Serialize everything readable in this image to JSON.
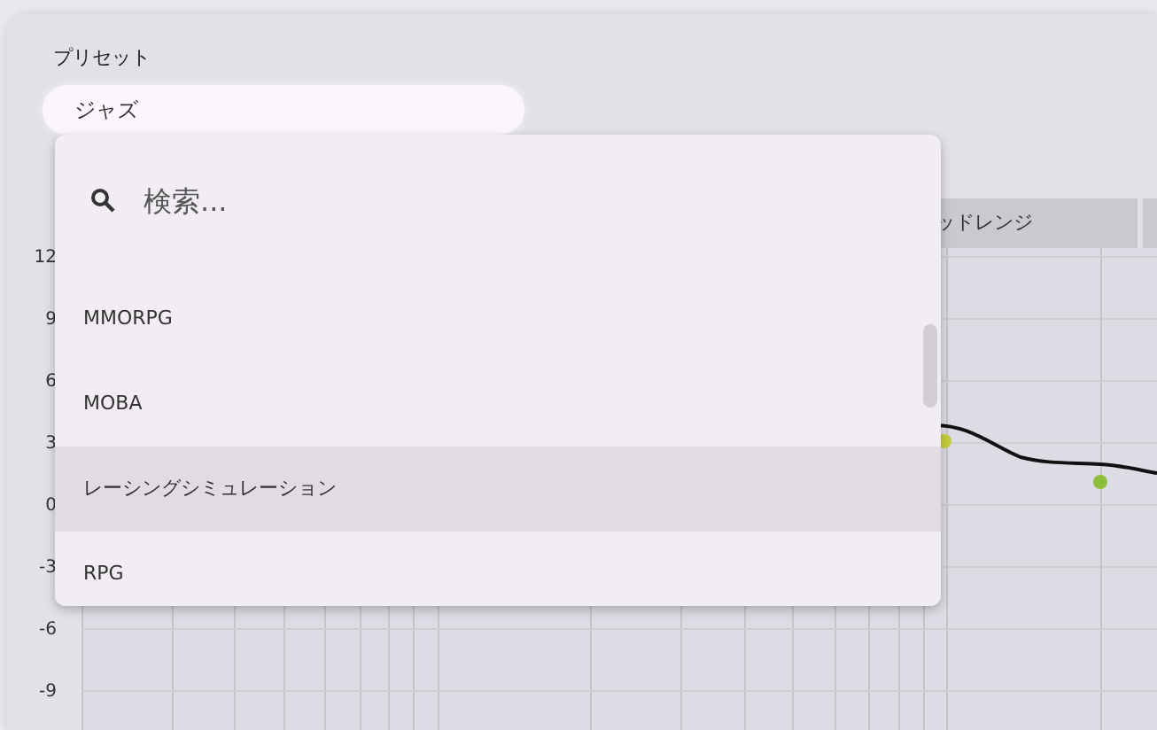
{
  "preset": {
    "label": "プリセット",
    "value": "ジャズ"
  },
  "chart": {
    "band_labels": [
      "ッドレンジ"
    ],
    "y_labels": [
      "12",
      "9",
      "6",
      "3",
      "0",
      "-3",
      "-6",
      "-9"
    ]
  },
  "dropdown": {
    "search": {
      "placeholder": "検索..."
    },
    "items": [
      {
        "label": "MMORPG",
        "selected": false
      },
      {
        "label": "MOBA",
        "selected": false
      },
      {
        "label": "レーシングシミュレーション",
        "selected": true
      },
      {
        "label": "RPG",
        "selected": false
      }
    ]
  }
}
